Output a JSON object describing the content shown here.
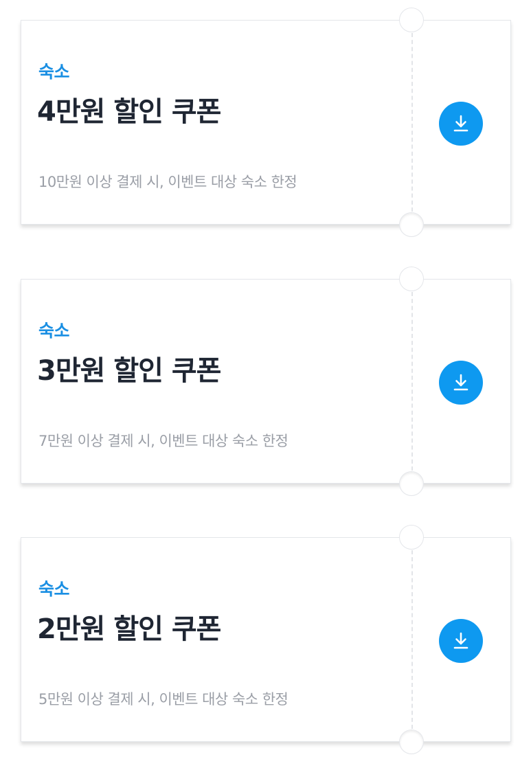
{
  "coupons": [
    {
      "category": "숙소",
      "title": "4만원 할인 쿠폰",
      "condition": "10만원 이상 결제 시, 이벤트 대상 숙소 한정",
      "action_icon": "download-icon"
    },
    {
      "category": "숙소",
      "title": "3만원 할인 쿠폰",
      "condition": "7만원 이상 결제 시, 이벤트 대상 숙소 한정",
      "action_icon": "download-icon"
    },
    {
      "category": "숙소",
      "title": "2만원 할인 쿠폰",
      "condition": "5만원 이상 결제 시, 이벤트 대상 숙소 한정",
      "action_icon": "download-icon"
    }
  ],
  "colors": {
    "category": "#1a8fe3",
    "title": "#1f2633",
    "condition": "#9a9ea6",
    "download_button": "#0e99f0",
    "border": "#e4e6ea"
  }
}
